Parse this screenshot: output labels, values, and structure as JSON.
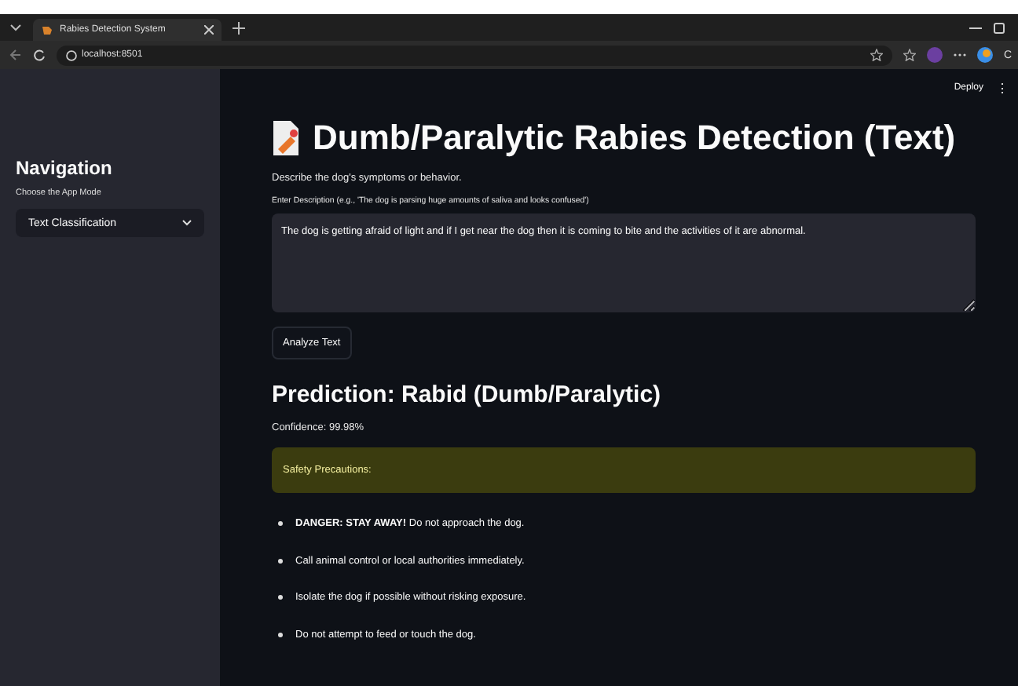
{
  "browser": {
    "tab_title": "Rabies Detection System",
    "url": "localhost:8501",
    "profile_letter": "C"
  },
  "toolbar": {
    "deploy": "Deploy",
    "menu": "⋮"
  },
  "sidebar": {
    "title": "Navigation",
    "mode_label": "Choose the App Mode",
    "mode_value": "Text Classification"
  },
  "main": {
    "title": "Dumb/Paralytic Rabies Detection (Text)",
    "subtitle": "Describe the dog's symptoms or behavior.",
    "input_label": "Enter Description (e.g., 'The dog is parsing huge amounts of saliva and looks confused')",
    "input_value": "The dog is getting afraid of light and if I get near the dog then it is coming to bite and the activities of it are abnormal.",
    "button": "Analyze Text",
    "prediction": "Prediction: Rabid (Dumb/Paralytic)",
    "confidence": "Confidence: 99.98%",
    "alert": "Safety Precautions:",
    "bullets": [
      "**DANGER: STAY AWAY!** Do not approach the dog.",
      "Call animal control or local authorities immediately.",
      "Isolate the dog if possible without risking exposure.",
      "Do not attempt to feed or touch the dog."
    ]
  }
}
